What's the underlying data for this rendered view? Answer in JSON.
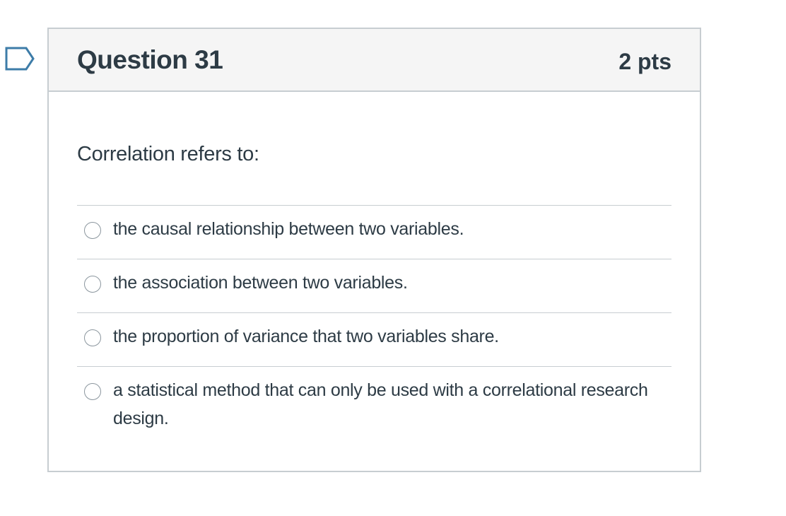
{
  "question": {
    "title": "Question 31",
    "points": "2 pts",
    "text": "Correlation refers to:",
    "answers": [
      {
        "label": "the causal relationship between two variables.",
        "selected": false
      },
      {
        "label": "the association between two variables.",
        "selected": false
      },
      {
        "label": "the proportion of variance that two variables share.",
        "selected": false
      },
      {
        "label": "a statistical method that can only be used with a correlational research design.",
        "selected": false
      }
    ]
  },
  "flag": {
    "icon": "bookmark-flag-icon",
    "color": "#3d7ca8"
  },
  "colors": {
    "text": "#2d3b45",
    "border": "#c7cdd1",
    "header_bg": "#f5f5f5"
  }
}
